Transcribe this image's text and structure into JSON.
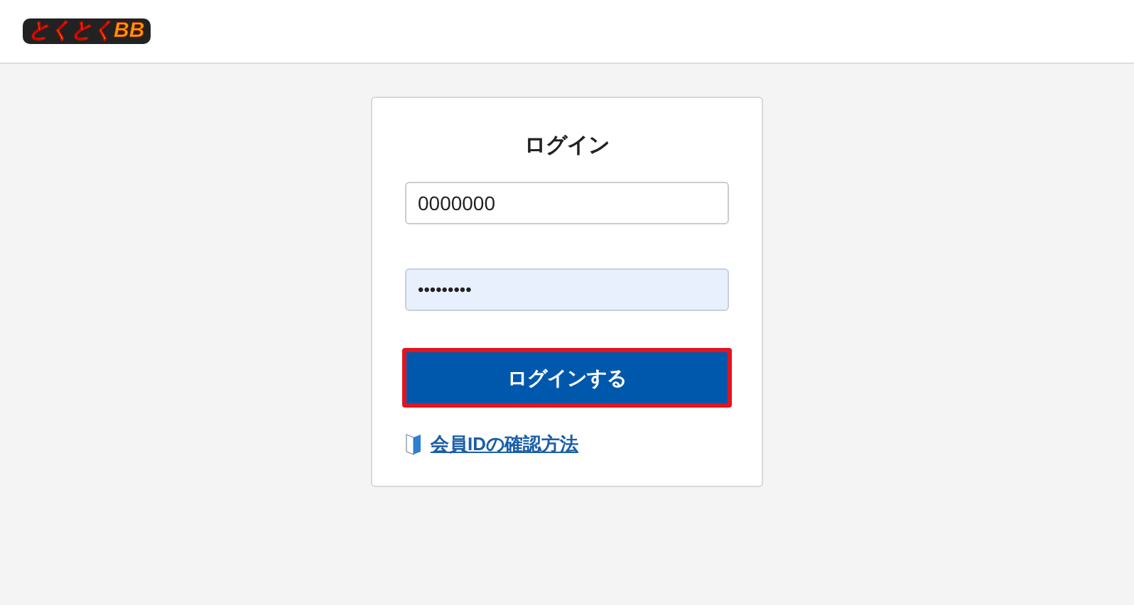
{
  "header": {
    "logo": "とくとくBB"
  },
  "login": {
    "title": "ログイン",
    "member_id": {
      "value": "0000000"
    },
    "password": {
      "value": "•••••••••",
      "autofilled": true
    },
    "submit": {
      "label": "ログインする",
      "focused": true
    },
    "help_link": "会員IDの確認方法"
  }
}
